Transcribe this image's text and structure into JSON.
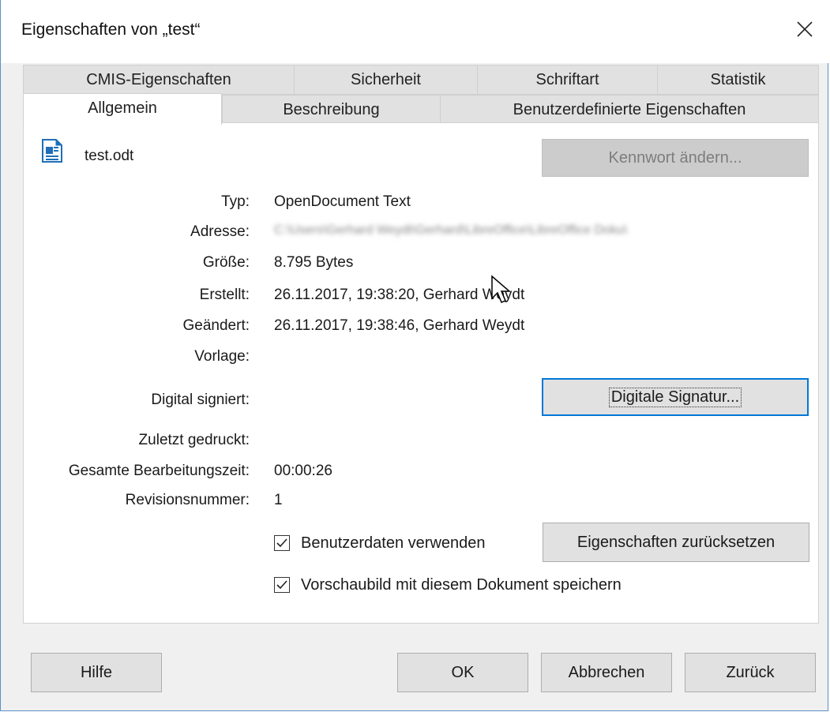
{
  "window": {
    "title": "Eigenschaften von „test“"
  },
  "tabs": {
    "back_row": [
      "CMIS-Eigenschaften",
      "Sicherheit",
      "Schriftart",
      "Statistik"
    ],
    "front_row": [
      "Allgemein",
      "Beschreibung",
      "Benutzerdefinierte Eigenschaften"
    ],
    "active": "Allgemein"
  },
  "file": {
    "name": "test.odt",
    "icon": "writer-document-icon"
  },
  "buttons": {
    "change_password": "Kennwort ändern...",
    "digital_signature": "Digitale Signatur...",
    "reset_properties": "Eigenschaften zurücksetzen",
    "help": "Hilfe",
    "ok": "OK",
    "cancel": "Abbrechen",
    "back": "Zurück"
  },
  "fields": {
    "type_label": "Typ:",
    "type_value": "OpenDocument Text",
    "address_label": "Adresse:",
    "address_value": "C:\\Users\\Gerhard Weydt\\Gerhard\\LibreOffice\\LibreOffice Doku\\",
    "size_label": "Größe:",
    "size_value": "8.795 Bytes",
    "created_label": "Erstellt:",
    "created_value": "26.11.2017, 19:38:20, Gerhard Weydt",
    "modified_label": "Geändert:",
    "modified_value": "26.11.2017, 19:38:46, Gerhard Weydt",
    "template_label": "Vorlage:",
    "template_value": "",
    "signed_label": "Digital signiert:",
    "printed_label": "Zuletzt gedruckt:",
    "printed_value": "",
    "edit_time_label": "Gesamte Bearbeitungszeit:",
    "edit_time_value": "00:00:26",
    "revision_label": "Revisionsnummer:",
    "revision_value": "1"
  },
  "checkboxes": {
    "use_user_data": {
      "label": "Benutzerdaten verwenden",
      "checked": true
    },
    "save_preview": {
      "label": "Vorschaubild mit diesem Dokument speichern",
      "checked": true
    }
  },
  "colors": {
    "focus_border": "#0078d7",
    "window_border": "#5b8fc9"
  }
}
